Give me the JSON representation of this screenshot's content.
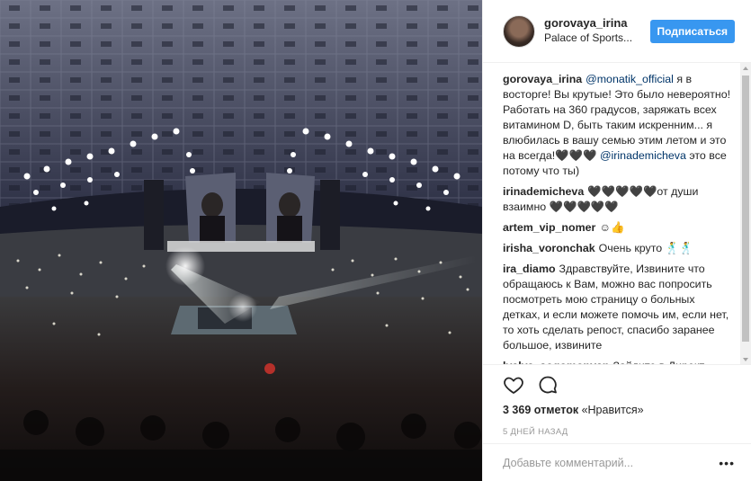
{
  "header": {
    "username": "gorovaya_irina",
    "location": "Palace of Sports...",
    "follow_label": "Подписаться"
  },
  "comments": [
    {
      "user": "gorovaya_irina",
      "parts": [
        {
          "t": "@monatik_official",
          "m": true
        },
        {
          "t": " я в восторге! Вы крутые! Это было невероятно! Работать на 360 градусов, заряжать всех витамином D, быть таким искренним... я влюбилась в вашу семью этим летом и это на всегда!🖤🖤🖤 "
        },
        {
          "t": "@irinademicheva",
          "m": true
        },
        {
          "t": " это все потому что ты)"
        }
      ]
    },
    {
      "user": "irinademicheva",
      "parts": [
        {
          "t": "🖤🖤🖤🖤🖤от души взаимно 🖤🖤🖤🖤🖤"
        }
      ]
    },
    {
      "user": "artem_vip_nomer",
      "parts": [
        {
          "t": "☺👍"
        }
      ]
    },
    {
      "user": "irisha_voronchak",
      "parts": [
        {
          "t": "Очень круто 🕺🕺"
        }
      ]
    },
    {
      "user": "ira_diamo",
      "parts": [
        {
          "t": "Здравствуйте, Извините что обращаюсь к Вам, можно вас попросить посмотреть мою страницу о больных детках, и если можете помочь им, если нет, то хоть сделать репост, спасибо заранее большое, извините"
        }
      ]
    },
    {
      "user": "lyalya_sogomonyan",
      "parts": [
        {
          "t": "Зайдите в Директ пожалуйста."
        }
      ]
    }
  ],
  "actions": {
    "likes_count": "3 369 отметок",
    "likes_suffix": " «Нравится»",
    "time": "5 дней назад"
  },
  "add_comment": {
    "placeholder": "Добавьте комментарий...",
    "more": "•••"
  },
  "icons": {
    "like": "heart-outline-icon",
    "comment": "speech-bubble-icon",
    "more": "more-dots-icon"
  },
  "colors": {
    "follow_button": "#3897f0",
    "mention": "#003569",
    "muted": "#999999"
  }
}
